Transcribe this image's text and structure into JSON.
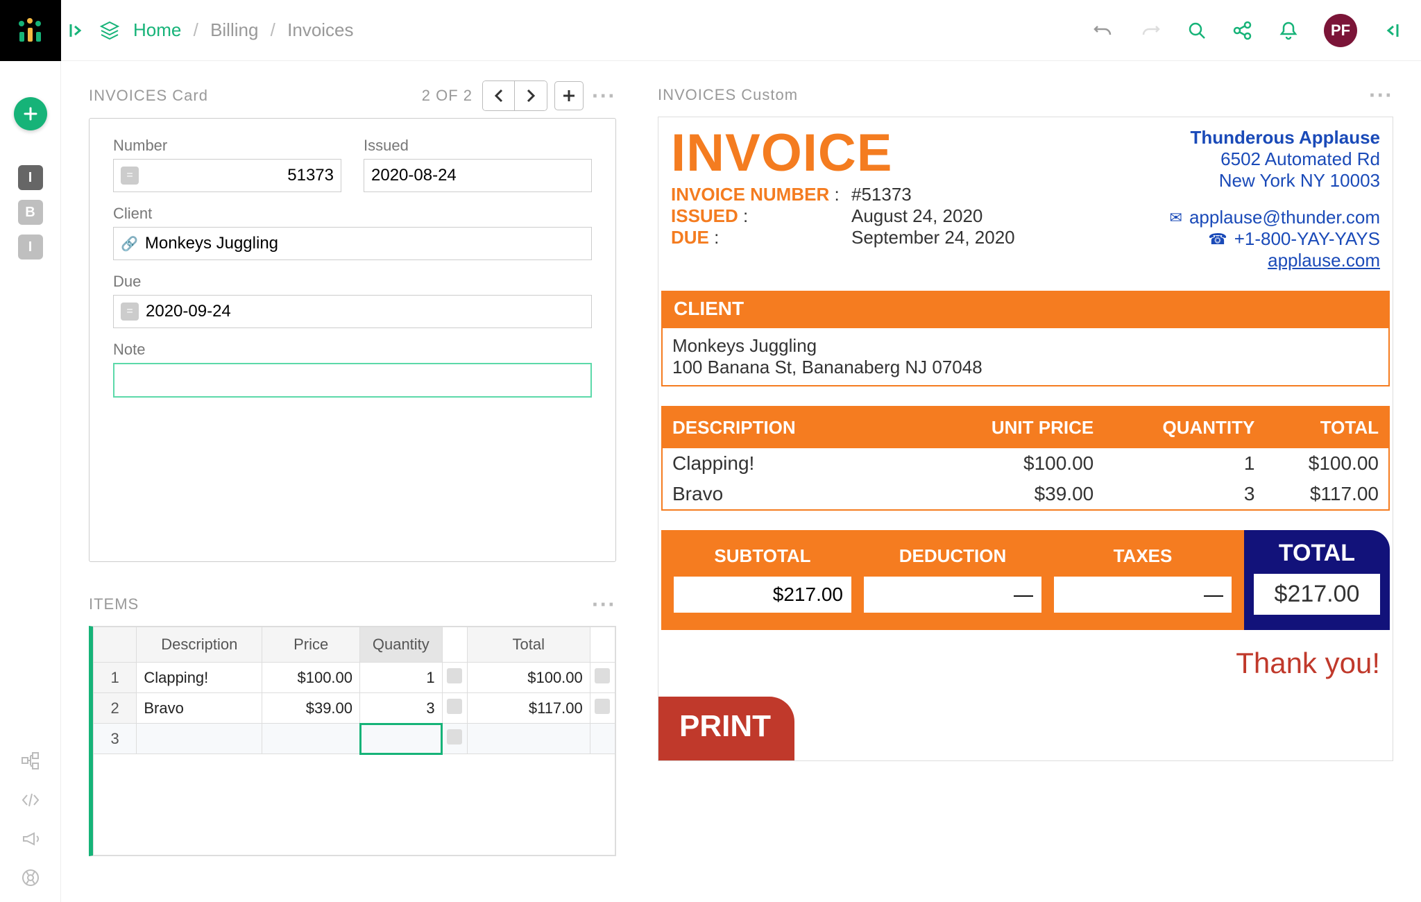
{
  "breadcrumb": {
    "home": "Home",
    "billing": "Billing",
    "invoices": "Invoices"
  },
  "avatar": "PF",
  "leftNav": {
    "items": [
      "I",
      "B",
      "I"
    ],
    "activeIndex": 0
  },
  "cardPanel": {
    "title": "INVOICES Card",
    "pager": "2 OF 2",
    "labels": {
      "number": "Number",
      "issued": "Issued",
      "client": "Client",
      "due": "Due",
      "note": "Note"
    },
    "values": {
      "number": "51373",
      "issued": "2020-08-24",
      "client": "Monkeys Juggling",
      "due": "2020-09-24",
      "note": ""
    }
  },
  "itemsPanel": {
    "title": "ITEMS",
    "headers": {
      "description": "Description",
      "price": "Price",
      "quantity": "Quantity",
      "total": "Total"
    },
    "rows": [
      {
        "n": "1",
        "desc": "Clapping!",
        "price": "$100.00",
        "qty": "1",
        "total": "$100.00"
      },
      {
        "n": "2",
        "desc": "Bravo",
        "price": "$39.00",
        "qty": "3",
        "total": "$117.00"
      }
    ],
    "emptyRow": "3"
  },
  "previewPanel": {
    "title": "INVOICES Custom",
    "headerWord": "INVOICE",
    "labels": {
      "invoiceNumber": "INVOICE NUMBER",
      "issued": "ISSUED",
      "due": "DUE",
      "colon": ":"
    },
    "values": {
      "invoiceNumber": "#51373",
      "issued": "August 24, 2020",
      "due": "September 24, 2020"
    },
    "company": {
      "name": "Thunderous Applause",
      "addr1": "6502 Automated Rd",
      "addr2": "New York NY 10003",
      "email": "applause@thunder.com",
      "phone": "+1-800-YAY-YAYS",
      "web": "applause.com"
    },
    "client": {
      "label": "CLIENT",
      "name": "Monkeys Juggling",
      "addr": "100 Banana St, Bananaberg NJ 07048"
    },
    "lineHeaders": {
      "desc": "DESCRIPTION",
      "price": "UNIT PRICE",
      "qty": "QUANTITY",
      "total": "TOTAL"
    },
    "lines": [
      {
        "desc": "Clapping!",
        "price": "$100.00",
        "qty": "1",
        "total": "$100.00"
      },
      {
        "desc": "Bravo",
        "price": "$39.00",
        "qty": "3",
        "total": "$117.00"
      }
    ],
    "summary": {
      "subtotalLabel": "SUBTOTAL",
      "subtotal": "$217.00",
      "deductionLabel": "DEDUCTION",
      "deduction": "—",
      "taxesLabel": "TAXES",
      "taxes": "—",
      "totalLabel": "TOTAL",
      "total": "$217.00"
    },
    "thanks": "Thank you!",
    "print": "PRINT"
  }
}
